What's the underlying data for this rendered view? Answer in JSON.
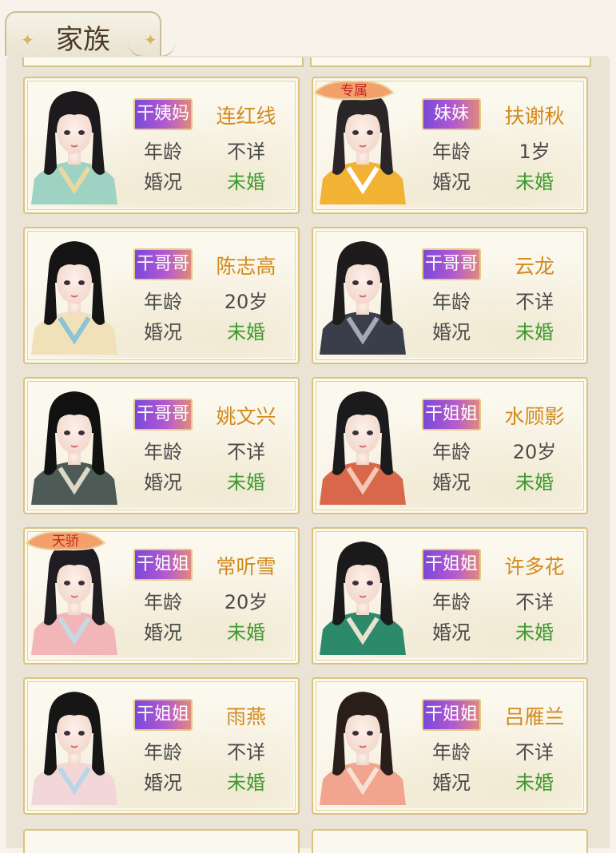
{
  "header": {
    "title": "家族"
  },
  "labels": {
    "age": "年龄",
    "marital": "婚况"
  },
  "colors": {
    "name": "#d28a1c",
    "married_status": "#3d9a2e",
    "badge_start": "#7a48d8",
    "badge_end": "#e08a7c"
  },
  "members": [
    {
      "relation": "干姨妈",
      "name": "连红线",
      "age": "不详",
      "marital": "未婚",
      "ribbon": "",
      "hair": "#1d1a1e",
      "robe": "#9ed3c4",
      "accent": "#e8d9a0"
    },
    {
      "relation": "妹妹",
      "name": "扶谢秋",
      "age": "1岁",
      "marital": "未婚",
      "ribbon": "专属",
      "hair": "#2a2628",
      "robe": "#f2b233",
      "accent": "#ffffff"
    },
    {
      "relation": "干哥哥",
      "name": "陈志高",
      "age": "20岁",
      "marital": "未婚",
      "ribbon": "",
      "hair": "#141414",
      "robe": "#f0e1b8",
      "accent": "#8cc3d8"
    },
    {
      "relation": "干哥哥",
      "name": "云龙",
      "age": "不详",
      "marital": "未婚",
      "ribbon": "",
      "hair": "#1d1b1b",
      "robe": "#3a3d4a",
      "accent": "#a5a9b7"
    },
    {
      "relation": "干哥哥",
      "name": "姚文兴",
      "age": "不详",
      "marital": "未婚",
      "ribbon": "",
      "hair": "#111111",
      "robe": "#4d5a56",
      "accent": "#ded9c6"
    },
    {
      "relation": "干姐姐",
      "name": "水顾影",
      "age": "20岁",
      "marital": "未婚",
      "ribbon": "",
      "hair": "#1b1b1d",
      "robe": "#d9674c",
      "accent": "#f3c9b5"
    },
    {
      "relation": "干姐姐",
      "name": "常听雪",
      "age": "20岁",
      "marital": "未婚",
      "ribbon": "天骄",
      "hair": "#1f1c22",
      "robe": "#f2b6b8",
      "accent": "#c4d9e6"
    },
    {
      "relation": "干姐姐",
      "name": "许多花",
      "age": "不详",
      "marital": "未婚",
      "ribbon": "",
      "hair": "#1a1a1a",
      "robe": "#2c8a6b",
      "accent": "#e9e2cf"
    },
    {
      "relation": "干姐姐",
      "name": "雨燕",
      "age": "不详",
      "marital": "未婚",
      "ribbon": "",
      "hair": "#161616",
      "robe": "#f3d6d8",
      "accent": "#b7d7e6"
    },
    {
      "relation": "干姐姐",
      "name": "吕雁兰",
      "age": "不详",
      "marital": "未婚",
      "ribbon": "",
      "hair": "#2a1e1a",
      "robe": "#f1a48e",
      "accent": "#f7e1d4"
    }
  ]
}
